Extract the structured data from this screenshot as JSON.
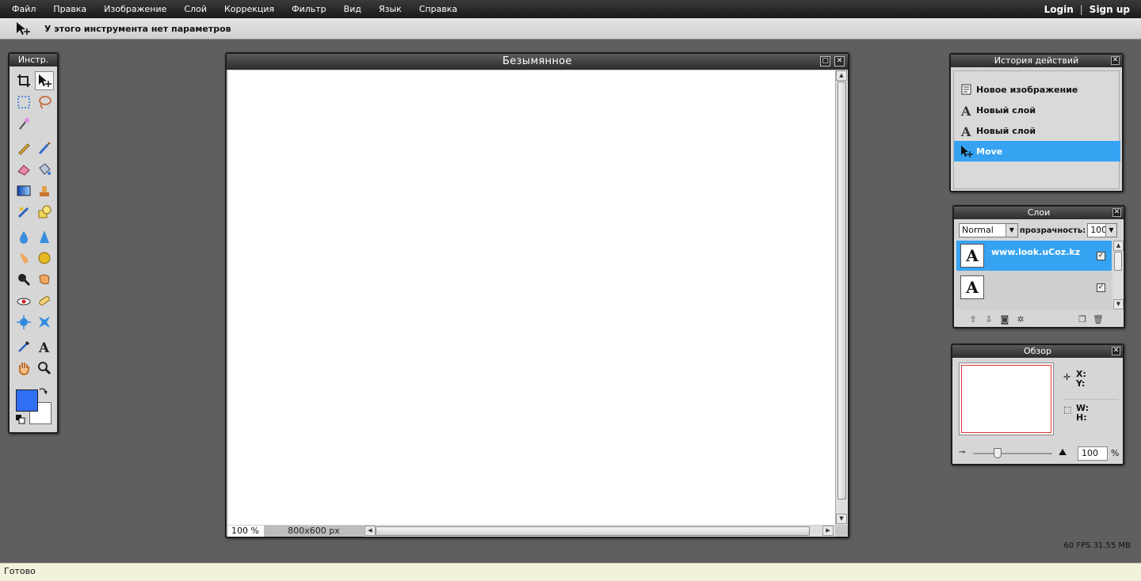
{
  "menu": [
    "Файл",
    "Правка",
    "Изображение",
    "Слой",
    "Коррекция",
    "Фильтр",
    "Вид",
    "Язык",
    "Справка"
  ],
  "auth": {
    "login": "Login",
    "separator": "|",
    "signup": "Sign up"
  },
  "options": {
    "tool_icon": "move-tool-icon",
    "text": "У этого инструмента нет параметров"
  },
  "tools_panel": {
    "title": "Инстр.",
    "tools": [
      "crop-icon",
      "move-icon",
      "marquee-icon",
      "lasso-icon",
      "magic-wand-icon",
      "pencil-icon",
      "brush-icon",
      "eraser-icon",
      "bucket-icon",
      "gradient-icon",
      "stamp-icon",
      "replace-color-icon",
      "shapes-icon",
      "blur-icon",
      "sharpen-icon",
      "smudge-icon",
      "sponge-icon",
      "dodge-icon",
      "burn-icon",
      "red-eye-icon",
      "spot-heal-icon",
      "bloat-icon",
      "pinch-icon",
      "eyedropper-icon",
      "type-icon",
      "hand-icon",
      "zoom-icon"
    ],
    "foreground_color": "#2f6ef5",
    "background_color": "#ffffff"
  },
  "document": {
    "title": "Безымянное",
    "zoom": "100 %",
    "size": "800x600 px",
    "canvas_color": "#ffffff"
  },
  "history": {
    "title": "История действий",
    "items": [
      {
        "label": "Новое изображение",
        "icon": "new-image-icon",
        "active": false
      },
      {
        "label": "Новый слой",
        "icon": "type-layer-icon",
        "active": false
      },
      {
        "label": "Новый слой",
        "icon": "type-layer-icon",
        "active": false
      },
      {
        "label": "Move",
        "icon": "move-icon",
        "active": true
      }
    ]
  },
  "layers": {
    "title": "Слои",
    "blend_mode": "Normal",
    "opacity_label": "прозрачность:",
    "opacity": "100",
    "items": [
      {
        "name": "www.look.uCoz.kz",
        "thumb": "A",
        "visible": "✓",
        "active": true
      },
      {
        "name": "",
        "thumb": "A",
        "visible": "✓",
        "active": false
      }
    ]
  },
  "navigator": {
    "title": "Обзор",
    "x_label": "X:",
    "y_label": "Y:",
    "w_label": "W:",
    "h_label": "H:",
    "zoom": "100",
    "zoom_unit": "%"
  },
  "perf": "60 FPS 31.55 MB",
  "status": "Готово",
  "accent": "#36a3f2"
}
